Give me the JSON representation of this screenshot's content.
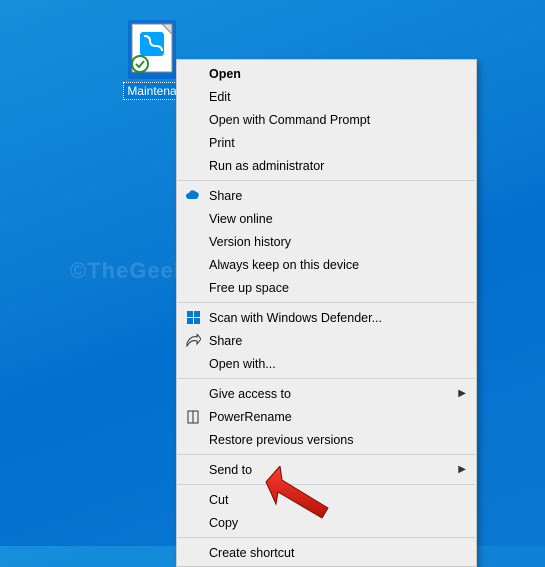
{
  "desktop": {
    "icon_label": "Maintena"
  },
  "menu": {
    "open": "Open",
    "edit": "Edit",
    "open_cmd": "Open with Command Prompt",
    "print": "Print",
    "run_admin": "Run as administrator",
    "share": "Share",
    "view_online": "View online",
    "version_history": "Version history",
    "always_keep": "Always keep on this device",
    "free_up": "Free up space",
    "defender": "Scan with Windows Defender...",
    "share2": "Share",
    "open_with": "Open with...",
    "give_access": "Give access to",
    "powerrename": "PowerRename",
    "restore_prev": "Restore previous versions",
    "send_to": "Send to",
    "cut": "Cut",
    "copy": "Copy",
    "create_shortcut": "Create shortcut"
  },
  "watermark": "©TheGeekPage.com"
}
